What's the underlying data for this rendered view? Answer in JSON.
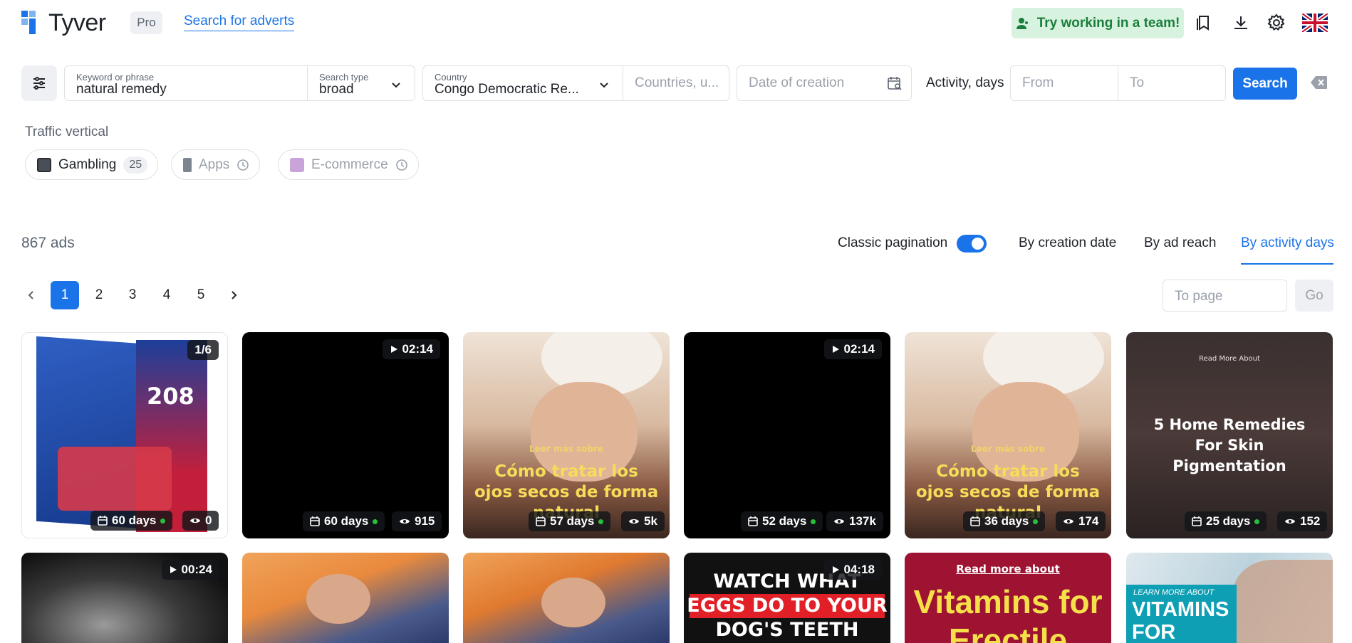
{
  "header": {
    "logo_text": "Tyver",
    "plan_badge": "Pro",
    "nav_link": "Search for adverts",
    "team_button": "Try working in a team!",
    "icons": [
      "bookmarks-icon",
      "download-icon",
      "gear-icon",
      "uk-flag-icon"
    ]
  },
  "search": {
    "keyword_label": "Keyword or phrase",
    "keyword_value": "natural remedy",
    "type_label": "Search type",
    "type_value": "broad",
    "country_label": "Country",
    "country_value": "Congo Democratic Re...",
    "countries_placeholder": "Countries, u...",
    "date_placeholder": "Date of creation",
    "activity_label": "Activity, days",
    "from_placeholder": "From",
    "to_placeholder": "To",
    "search_button": "Search"
  },
  "traffic_vertical": {
    "label": "Traffic vertical",
    "chips": [
      {
        "label": "Gambling",
        "count": "25",
        "enabled": true
      },
      {
        "label": "Apps",
        "enabled": false
      },
      {
        "label": "E-commerce",
        "enabled": false
      }
    ]
  },
  "results": {
    "count": "867 ads",
    "classic_pagination_label": "Classic pagination",
    "classic_pagination_on": true,
    "sort_options": [
      "By creation date",
      "By ad reach",
      "By activity days"
    ],
    "active_sort": "By activity days"
  },
  "pagination": {
    "pages": [
      "1",
      "2",
      "3",
      "4",
      "5"
    ],
    "active_page": "1",
    "to_page_placeholder": "To page",
    "go_button": "Go"
  },
  "cards": [
    {
      "badge": "1/6",
      "days": "60 days",
      "views": "0"
    },
    {
      "badge": "02:14",
      "days": "60 days",
      "views": "915"
    },
    {
      "pre": "Leer más sobre",
      "caption": "Cómo tratar los ojos secos de forma natural",
      "days": "57 days",
      "views": "5k"
    },
    {
      "badge": "02:14",
      "days": "52 days",
      "views": "137k"
    },
    {
      "pre": "Leer más sobre",
      "caption": "Cómo tratar los ojos secos de forma natural",
      "days": "36 days",
      "views": "174"
    },
    {
      "pre": "Read More About",
      "caption": "5 Home Remedies For Skin Pigmentation",
      "days": "25 days",
      "views": "152"
    }
  ],
  "cards_row2": [
    {
      "badge": "00:24"
    },
    {},
    {},
    {
      "badge": "04:18",
      "caption_lines": [
        "WATCH WHAT",
        "EGGS DO TO YOUR",
        "DOG'S TEETH"
      ]
    },
    {
      "pre": "Read more about",
      "caption_lines": [
        "Vitamins for",
        "Erectile"
      ]
    },
    {
      "pre": "LEARN MORE ABOUT",
      "caption_lines": [
        "VITAMINS",
        "FOR"
      ]
    }
  ],
  "colors": {
    "accent": "#1a73e8",
    "team_bg": "#d8f2e0",
    "team_text": "#1a7f3c",
    "active_dot": "#26c03a"
  }
}
